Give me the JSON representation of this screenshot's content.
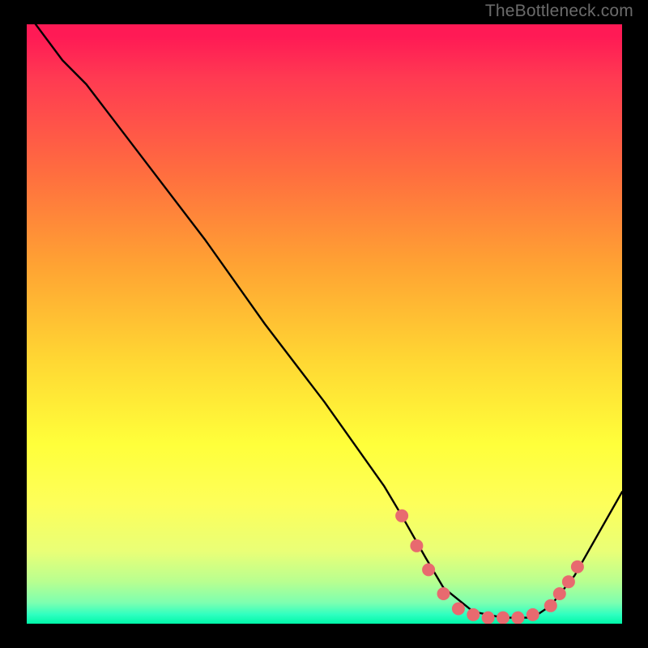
{
  "watermark": {
    "text": "TheBottleneck.com"
  },
  "chart_data": {
    "type": "line",
    "title": "",
    "xlabel": "",
    "ylabel": "",
    "xlim": [
      0,
      100
    ],
    "ylim": [
      0,
      100
    ],
    "series": [
      {
        "name": "bottleneck-curve",
        "x": [
          0,
          6,
          10,
          20,
          30,
          40,
          50,
          60,
          63,
          67,
          70,
          75,
          80,
          85,
          88,
          92,
          100
        ],
        "y": [
          102,
          94,
          90,
          77,
          64,
          50,
          37,
          23,
          18,
          11,
          6,
          2,
          1,
          1,
          3,
          8,
          22
        ]
      }
    ],
    "markers": {
      "name": "highlighted-points",
      "color": "#e86a6f",
      "radius": 8,
      "points": [
        {
          "x": 63,
          "y": 18
        },
        {
          "x": 65.5,
          "y": 13
        },
        {
          "x": 67.5,
          "y": 9
        },
        {
          "x": 70,
          "y": 5
        },
        {
          "x": 72.5,
          "y": 2.5
        },
        {
          "x": 75,
          "y": 1.5
        },
        {
          "x": 77.5,
          "y": 1
        },
        {
          "x": 80,
          "y": 1
        },
        {
          "x": 82.5,
          "y": 1
        },
        {
          "x": 85,
          "y": 1.5
        },
        {
          "x": 88,
          "y": 3
        },
        {
          "x": 89.5,
          "y": 5
        },
        {
          "x": 91,
          "y": 7
        },
        {
          "x": 92.5,
          "y": 9.5
        }
      ]
    },
    "gradient_stops": [
      {
        "pct": 0,
        "color": "#ff1a55"
      },
      {
        "pct": 25,
        "color": "#ff6e3f"
      },
      {
        "pct": 56,
        "color": "#ffd733"
      },
      {
        "pct": 80,
        "color": "#fdff5a"
      },
      {
        "pct": 96.5,
        "color": "#7dffb0"
      },
      {
        "pct": 100,
        "color": "#00f7a8"
      }
    ]
  }
}
